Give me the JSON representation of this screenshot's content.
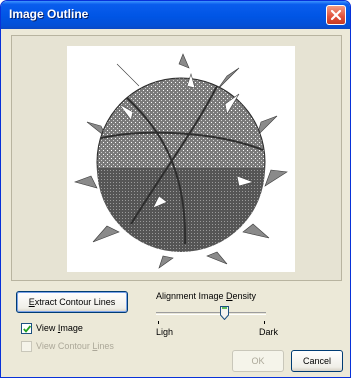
{
  "window": {
    "title": "Image Outline"
  },
  "buttons": {
    "extract": {
      "pre": "",
      "accel": "E",
      "post": "xtract Contour Lines"
    },
    "ok": "OK",
    "cancel": "Cancel"
  },
  "slider": {
    "label_pre": "Alignment Image ",
    "label_accel": "D",
    "label_post": "ensity",
    "min_label": "Ligh",
    "max_label": "Dark",
    "value": 0.62
  },
  "checkboxes": {
    "view_image": {
      "pre": "View ",
      "accel": "I",
      "post": "mage",
      "checked": true,
      "enabled": true
    },
    "view_contour": {
      "pre": "View Contour ",
      "accel": "L",
      "post": "ines",
      "checked": false,
      "enabled": false
    }
  },
  "icons": {
    "close": "close-icon",
    "check": "check-icon"
  }
}
